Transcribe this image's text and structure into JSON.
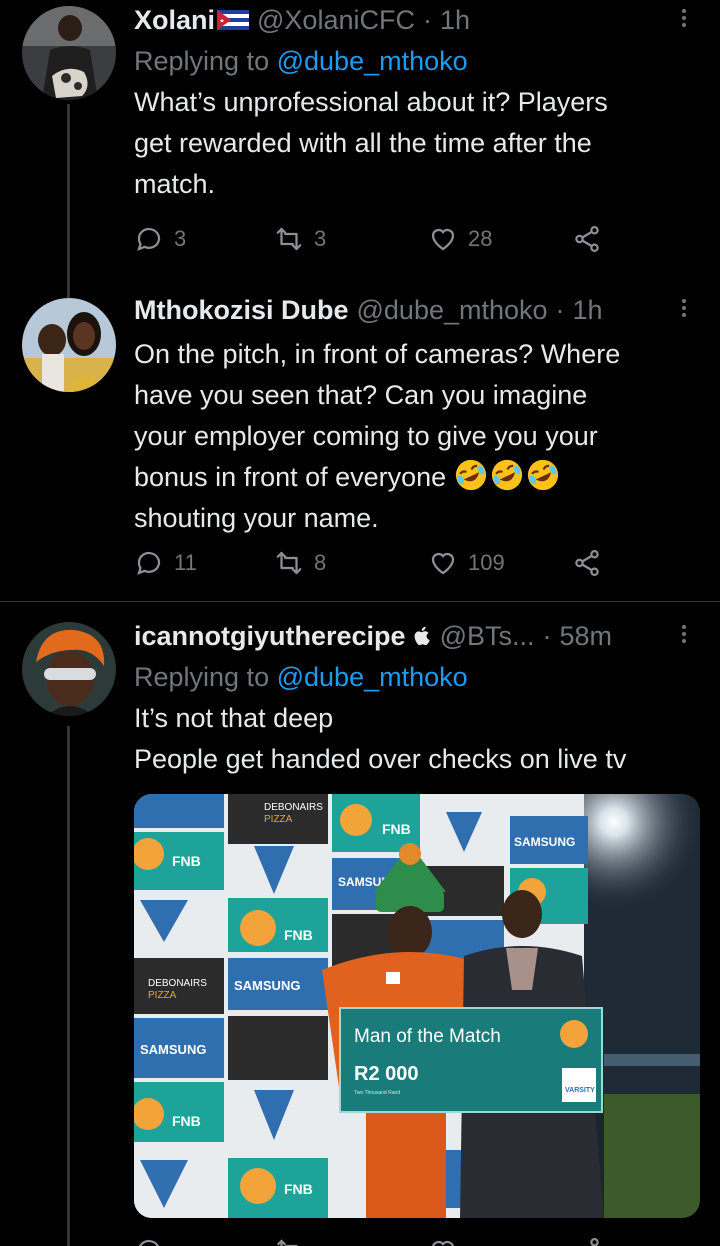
{
  "tweets": [
    {
      "name": "Xolani",
      "handle": "@XolaniCFC",
      "time": "1h",
      "reply_prefix": "Replying to",
      "reply_mention": "@dube_mthoko",
      "lines": [
        "What’s unprofessional about it? Players",
        "get rewarded with all the time after the",
        "match."
      ],
      "replies": "3",
      "retweets": "3",
      "likes": "28"
    },
    {
      "name": "Mthokozisi Dube",
      "handle": "@dube_mthoko",
      "time": "1h",
      "lines": [
        "On the pitch, in front of cameras? Where",
        "have you seen that? Can you imagine",
        "your employer coming to give you your",
        "bonus in front of everyone",
        "shouting your name."
      ],
      "emoji": "rolling-on-floor-laughing x3",
      "replies": "11",
      "retweets": "8",
      "likes": "109"
    },
    {
      "name": "icannotgiyutherecipe",
      "handle": "@BTs...",
      "time": "58m",
      "reply_prefix": "Replying to",
      "reply_mention": "@dube_mthoko",
      "lines": [
        "It’s not that deep",
        "People get handed over checks on live tv"
      ]
    }
  ],
  "media": {
    "banner_title": "Man of the Match",
    "banner_amount": "R2 000",
    "banner_small": "Two Thousand Rand",
    "sponsors": [
      "FNB",
      "SAMSUNG",
      "DEBONAIRS",
      "PIZZA",
      "VARSITY"
    ]
  },
  "colors": {
    "link": "#1d9bf0",
    "muted": "#71767b",
    "text": "#e7e9ea",
    "bg": "#000000"
  }
}
